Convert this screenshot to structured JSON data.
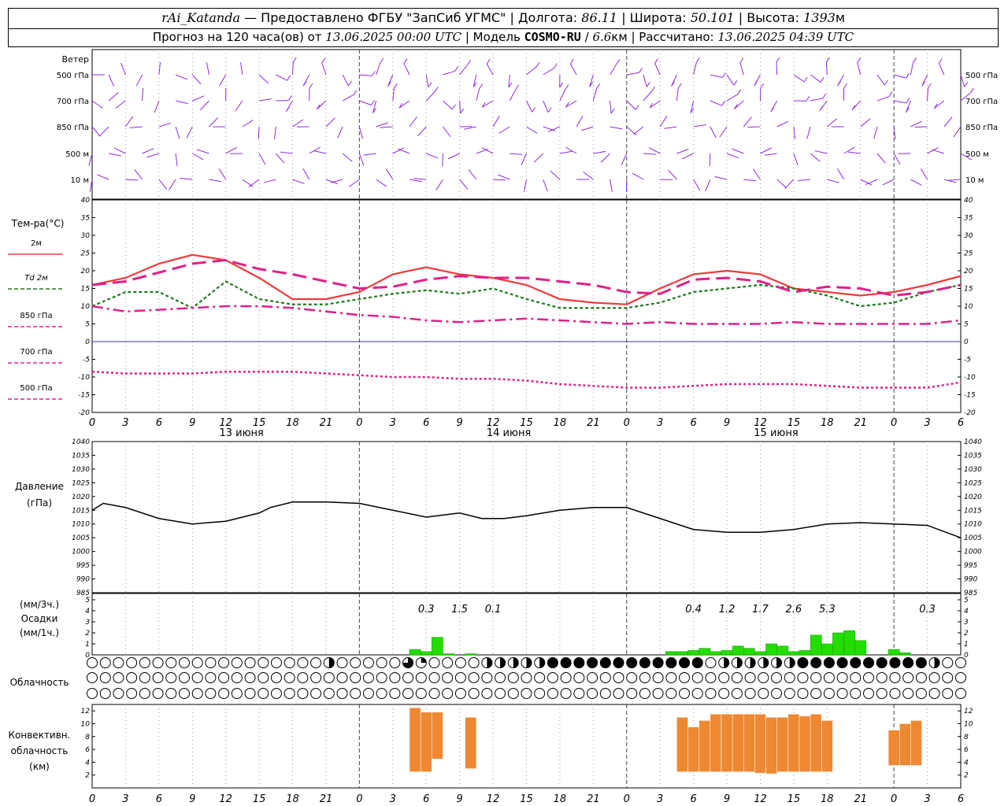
{
  "header": {
    "station": "rAi_Katanda",
    "provider": "— Предоставлено ФГБУ \"ЗапСиб УГМС\"",
    "lon_label": "Долгота:",
    "lon_value": "86.11",
    "lat_label": "Широта:",
    "lat_value": "50.101",
    "alt_label": "Высота:",
    "alt_value": "1393",
    "alt_unit": "м",
    "forecast_prefix": "Прогноз на 120 часа(ов) от",
    "forecast_start": "13.06.2025 00:00 UTC",
    "model_label": "Модель",
    "model_name": "COSMO-RU",
    "model_res": "6.6",
    "model_res_unit": "км",
    "calc_label": "Рассчитано:",
    "calc_time": "13.06.2025 04:39 UTC"
  },
  "labels": {
    "wind": "Ветер",
    "wind_levels": [
      "500 гПа",
      "700 гПа",
      "850 гПа",
      "500 м",
      "10 м"
    ],
    "temp": "Тем-ра(°С)",
    "temp_legend": [
      "2м",
      "Td  2м",
      "850 гПа",
      "700 гПа",
      "500 гПа"
    ],
    "pressure": "Давление",
    "pressure_unit": "(гПа)",
    "precip_unit3": "(мм/3ч.)",
    "precip": "Осадки",
    "precip_unit1": "(мм/1ч.)",
    "cloud": "Облачность",
    "conv1": "Конвективн.",
    "conv2": "облачность",
    "conv3": "(км)"
  },
  "colors": {
    "wind": "#8a2be2",
    "t2m": "#ee3b3b",
    "td2m": "#1e7a1e",
    "t850": "#dd2288",
    "t700": "#dd2288",
    "t500": "#dd2288",
    "zero_line": "#3333cc",
    "pressure": "#000000",
    "precip_bar": "#22dd00",
    "conv_bar": "#ee8833"
  },
  "chart_data": [
    {
      "type": "line",
      "name": "temperature",
      "x_hours": [
        0,
        3,
        6,
        9,
        12,
        15,
        18,
        21,
        24,
        27,
        30,
        33,
        36,
        39,
        42,
        45,
        48,
        51,
        54,
        57,
        60,
        63,
        66,
        69,
        72,
        75,
        78
      ],
      "series": [
        {
          "name": "2м",
          "values": [
            16,
            18,
            22,
            24.5,
            23,
            18,
            12,
            12,
            14,
            19,
            21,
            19,
            18,
            16,
            12,
            11,
            10.5,
            15,
            19,
            20,
            19,
            15,
            14,
            13,
            14,
            16,
            18.5
          ]
        },
        {
          "name": "Td 2м",
          "values": [
            10,
            14,
            14,
            9.5,
            17,
            12,
            10.5,
            10.5,
            12,
            13.5,
            14.5,
            13.5,
            15,
            12,
            9.5,
            9.5,
            9.5,
            11,
            14,
            15,
            16,
            15,
            13,
            10,
            11,
            14,
            16
          ]
        },
        {
          "name": "850 гПа",
          "values": [
            16,
            17,
            19.5,
            22,
            23,
            20.5,
            19,
            17,
            15,
            15.5,
            17.5,
            18.5,
            18,
            18,
            17,
            16,
            14,
            13.5,
            17.5,
            18,
            17,
            14,
            15.5,
            15,
            13,
            14,
            16
          ]
        },
        {
          "name": "700 гПа",
          "values": [
            10,
            8.5,
            9,
            9.5,
            10,
            10,
            9.5,
            8.5,
            7.5,
            7,
            6,
            5.5,
            6,
            6.5,
            6,
            5.5,
            5,
            5.5,
            5,
            5,
            5,
            5.5,
            5,
            5,
            5,
            5,
            6
          ]
        },
        {
          "name": "500 гПа",
          "values": [
            -8.5,
            -9,
            -9,
            -9,
            -8.5,
            -8.5,
            -8.5,
            -9,
            -9.5,
            -10,
            -10,
            -10.5,
            -10.5,
            -11,
            -12,
            -12.5,
            -13,
            -13,
            -12.5,
            -12,
            -12,
            -12,
            -12.5,
            -13,
            -13,
            -13,
            -11.5
          ]
        }
      ],
      "ylim": [
        -20,
        40
      ],
      "ylabel": "Тем-ра(°С)"
    },
    {
      "type": "line",
      "name": "pressure",
      "x_hours": [
        0,
        1,
        3,
        6,
        9,
        12,
        15,
        16,
        18,
        21,
        24,
        27,
        30,
        33,
        35,
        37,
        39,
        42,
        45,
        48,
        51,
        54,
        57,
        60,
        63,
        66,
        69,
        72,
        75,
        78
      ],
      "values": [
        1015,
        1017.5,
        1016,
        1012,
        1010,
        1011,
        1014,
        1016,
        1018,
        1018,
        1017.5,
        1015,
        1012.5,
        1014,
        1012,
        1012,
        1013,
        1015,
        1016,
        1016,
        1012,
        1008,
        1007,
        1007,
        1008,
        1010,
        1010.5,
        1010,
        1009.5,
        1005
      ],
      "ylim": [
        985,
        1040
      ],
      "ylabel": "Давление"
    },
    {
      "type": "bar",
      "name": "precipitation",
      "bars_hourly": [
        [
          29,
          0.5
        ],
        [
          30,
          0.3
        ],
        [
          31,
          1.6
        ],
        [
          32,
          0.1
        ],
        [
          34,
          0.1
        ],
        [
          52,
          0.3
        ],
        [
          53,
          0.3
        ],
        [
          54,
          0.4
        ],
        [
          55,
          0.6
        ],
        [
          56,
          0.3
        ],
        [
          57,
          0.4
        ],
        [
          58,
          0.8
        ],
        [
          59,
          0.6
        ],
        [
          60,
          0.3
        ],
        [
          61,
          1.0
        ],
        [
          62,
          0.8
        ],
        [
          63,
          0.3
        ],
        [
          64,
          0.4
        ],
        [
          65,
          1.8
        ],
        [
          66,
          1.0
        ],
        [
          67,
          2.0
        ],
        [
          68,
          2.2
        ],
        [
          69,
          1.3
        ],
        [
          72,
          0.5
        ],
        [
          73,
          0.2
        ]
      ],
      "sums_3h": [
        {
          "hour": 30,
          "value": "0.3"
        },
        {
          "hour": 33,
          "value": "1.5"
        },
        {
          "hour": 36,
          "value": "0.1"
        },
        {
          "hour": 54,
          "value": "0.4"
        },
        {
          "hour": 57,
          "value": "1.2"
        },
        {
          "hour": 60,
          "value": "1.7"
        },
        {
          "hour": 63,
          "value": "2.6"
        },
        {
          "hour": 66,
          "value": "5.3"
        },
        {
          "hour": 75,
          "value": "0.3"
        }
      ],
      "ylim": [
        0,
        5
      ]
    },
    {
      "type": "bar",
      "name": "convective_cloud",
      "ranges_km": [
        [
          29,
          2.5,
          12.5
        ],
        [
          30,
          2.5,
          11.8
        ],
        [
          31,
          4.5,
          11.8
        ],
        [
          34,
          3,
          11
        ],
        [
          53,
          2.5,
          11
        ],
        [
          54,
          2.5,
          9.5
        ],
        [
          55,
          2.5,
          10.5
        ],
        [
          56,
          2.5,
          11.5
        ],
        [
          57,
          2.5,
          11.5
        ],
        [
          58,
          2.5,
          11.5
        ],
        [
          59,
          2.5,
          11.5
        ],
        [
          60,
          2.3,
          11.5
        ],
        [
          61,
          2.2,
          11
        ],
        [
          62,
          2.5,
          11
        ],
        [
          63,
          2.5,
          11.5
        ],
        [
          64,
          2.5,
          11.2
        ],
        [
          65,
          2.5,
          11.5
        ],
        [
          66,
          2.5,
          10.5
        ],
        [
          72,
          3.5,
          9
        ],
        [
          73,
          3.5,
          10
        ],
        [
          74,
          3.5,
          10.5
        ]
      ],
      "ylim": [
        0,
        13
      ]
    }
  ],
  "x_axis": {
    "tick_labels": [
      "0",
      "3",
      "6",
      "9",
      "12",
      "15",
      "18",
      "21",
      "0",
      "3",
      "6",
      "9",
      "12",
      "15",
      "18",
      "21",
      "0",
      "3",
      "6",
      "9",
      "12",
      "15",
      "18",
      "21",
      "0",
      "3",
      "6"
    ],
    "day_labels": [
      "13 июня",
      "14 июня",
      "15 июня"
    ],
    "temp_ticks": [
      "40",
      "35",
      "30",
      "25",
      "20",
      "15",
      "10",
      "5",
      "0",
      "-5",
      "-10",
      "-15",
      "-20"
    ],
    "press_ticks": [
      "1040",
      "1035",
      "1030",
      "1025",
      "1020",
      "1015",
      "1010",
      "1005",
      "1000",
      "995",
      "990",
      "985"
    ],
    "precip_ticks": [
      "5",
      "4",
      "3",
      "2",
      "1",
      "0"
    ],
    "conv_ticks": [
      "12",
      "10",
      "8",
      "6",
      "4",
      "2"
    ]
  },
  "cloud_rows": {
    "low": "000000000000000000200000310000222224444444444440222222444444444420000000000000000000000000000044444444444444444444444444444444444444444444444444444444444444",
    "mid": "000000000000000000000000000000000000000000000000000000000000000000000000000000000000000000000000000000000000000000000000000000000000000000000000000000000000",
    "high": "000000000000000000000000000000000000000000000000000000000000000000000000000000000000000000000000000000000000000000000000000000000000000000000000000000000000"
  }
}
